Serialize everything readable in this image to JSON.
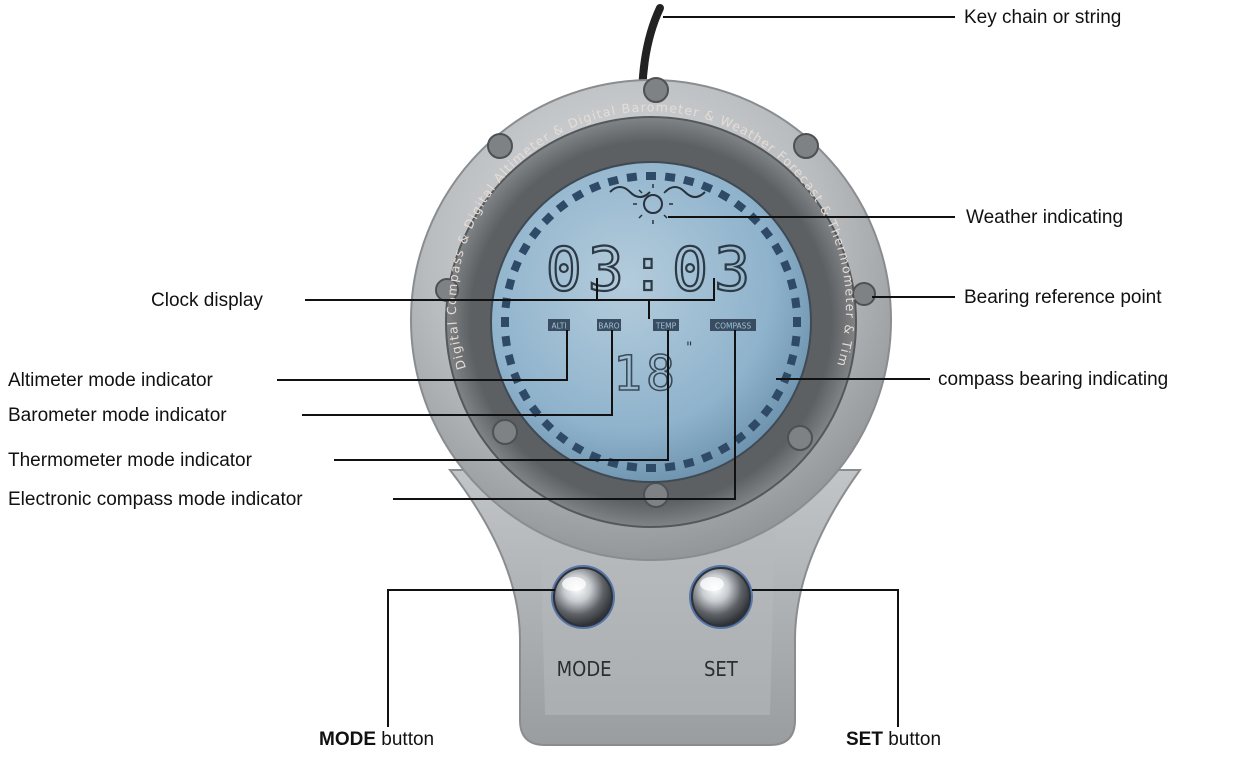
{
  "labels": {
    "key_chain": "Key chain or string",
    "weather": "Weather indicating",
    "bearing_ref": "Bearing reference point",
    "compass_bearing": "compass bearing indicating",
    "clock": "Clock display",
    "altimeter": "Altimeter mode indicator",
    "barometer": "Barometer mode indicator",
    "thermometer": "Thermometer mode indicator",
    "compass_mode": "Electronic compass mode indicator",
    "mode_button_bold": "MODE",
    "mode_button_rest": " button",
    "set_button_bold": "SET",
    "set_button_rest": " button"
  },
  "device": {
    "ring_text": "Digital Compass & Digital Altimeter & Digital Barometer & Weather Forecast & Thermometer & Time &",
    "clock_digits": "03:03",
    "temperature": "18",
    "temp_unit": "\"",
    "tags": [
      "ALTI",
      "BARO",
      "TEMP",
      "COMPASS"
    ],
    "button_mode_label": "MODE",
    "button_set_label": "SET"
  },
  "colors": {
    "lcd": "#8fb3cc",
    "housing": "#b9bcbf",
    "bezel": "#6e7174"
  }
}
